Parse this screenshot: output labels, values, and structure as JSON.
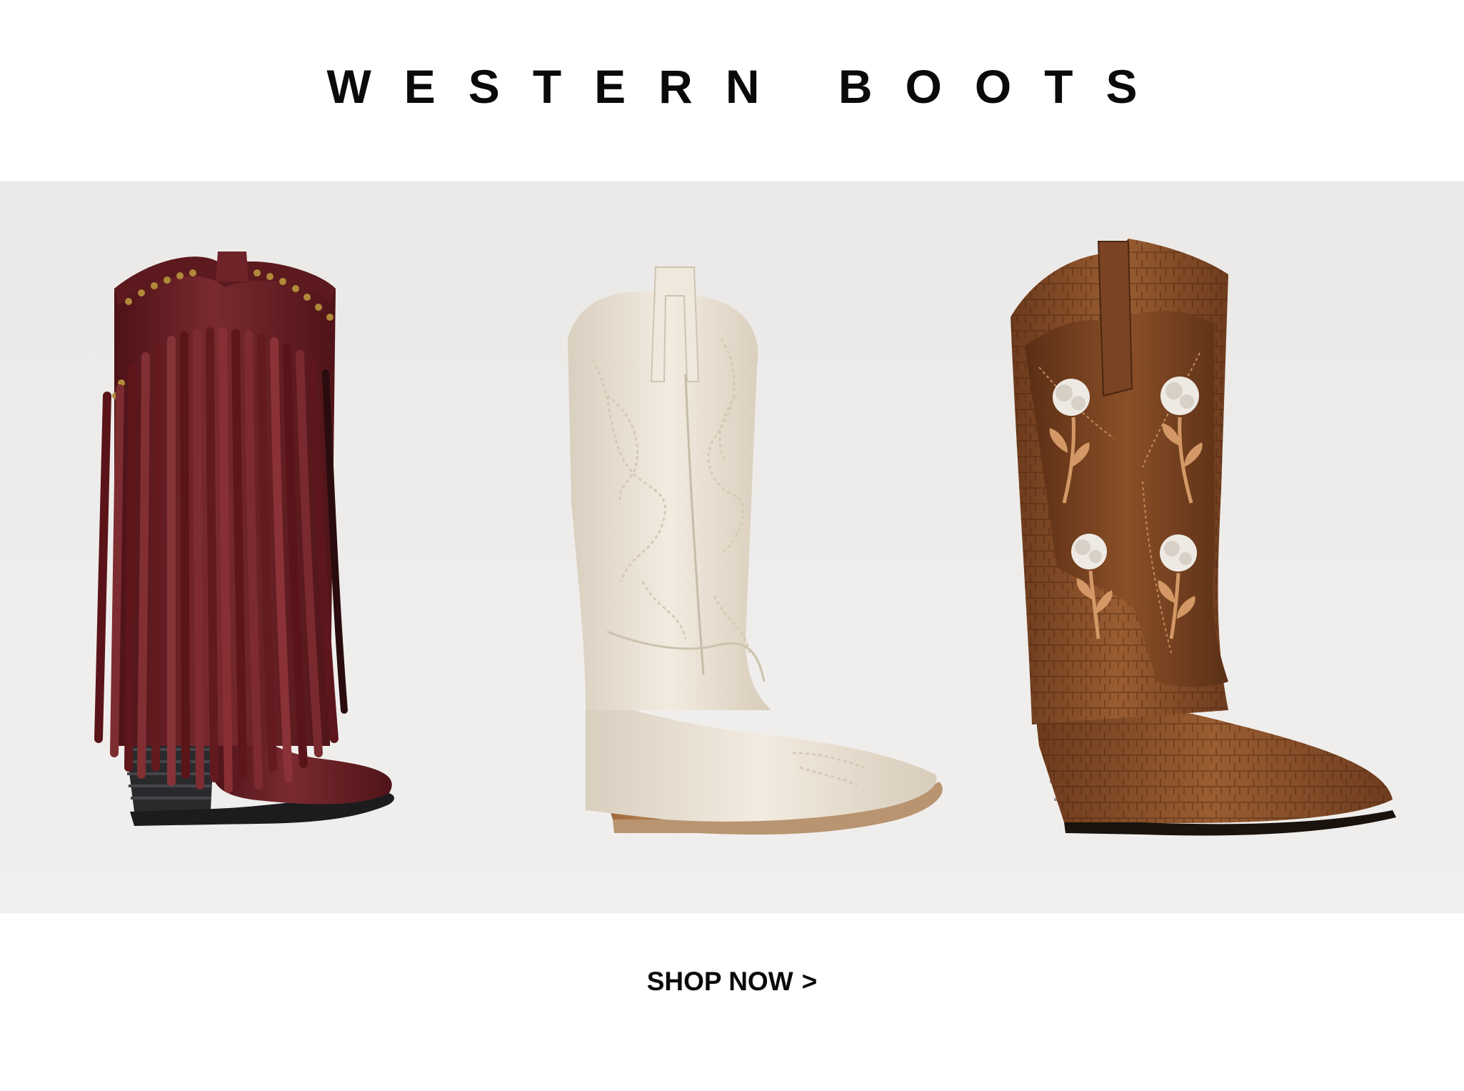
{
  "headline": "WESTERN BOOTS",
  "cta": {
    "label": "SHOP NOW",
    "chevron": ">"
  },
  "products": [
    {
      "icon": "fringe-boot-icon",
      "color": "#6b1e24"
    },
    {
      "icon": "embroidered-boot-icon",
      "color": "#eae1d2"
    },
    {
      "icon": "floral-croc-boot-icon",
      "color": "#7a4524"
    }
  ],
  "colors": {
    "background": "#ffffff",
    "banner": "#eeecea",
    "text": "#0a0a0a"
  }
}
